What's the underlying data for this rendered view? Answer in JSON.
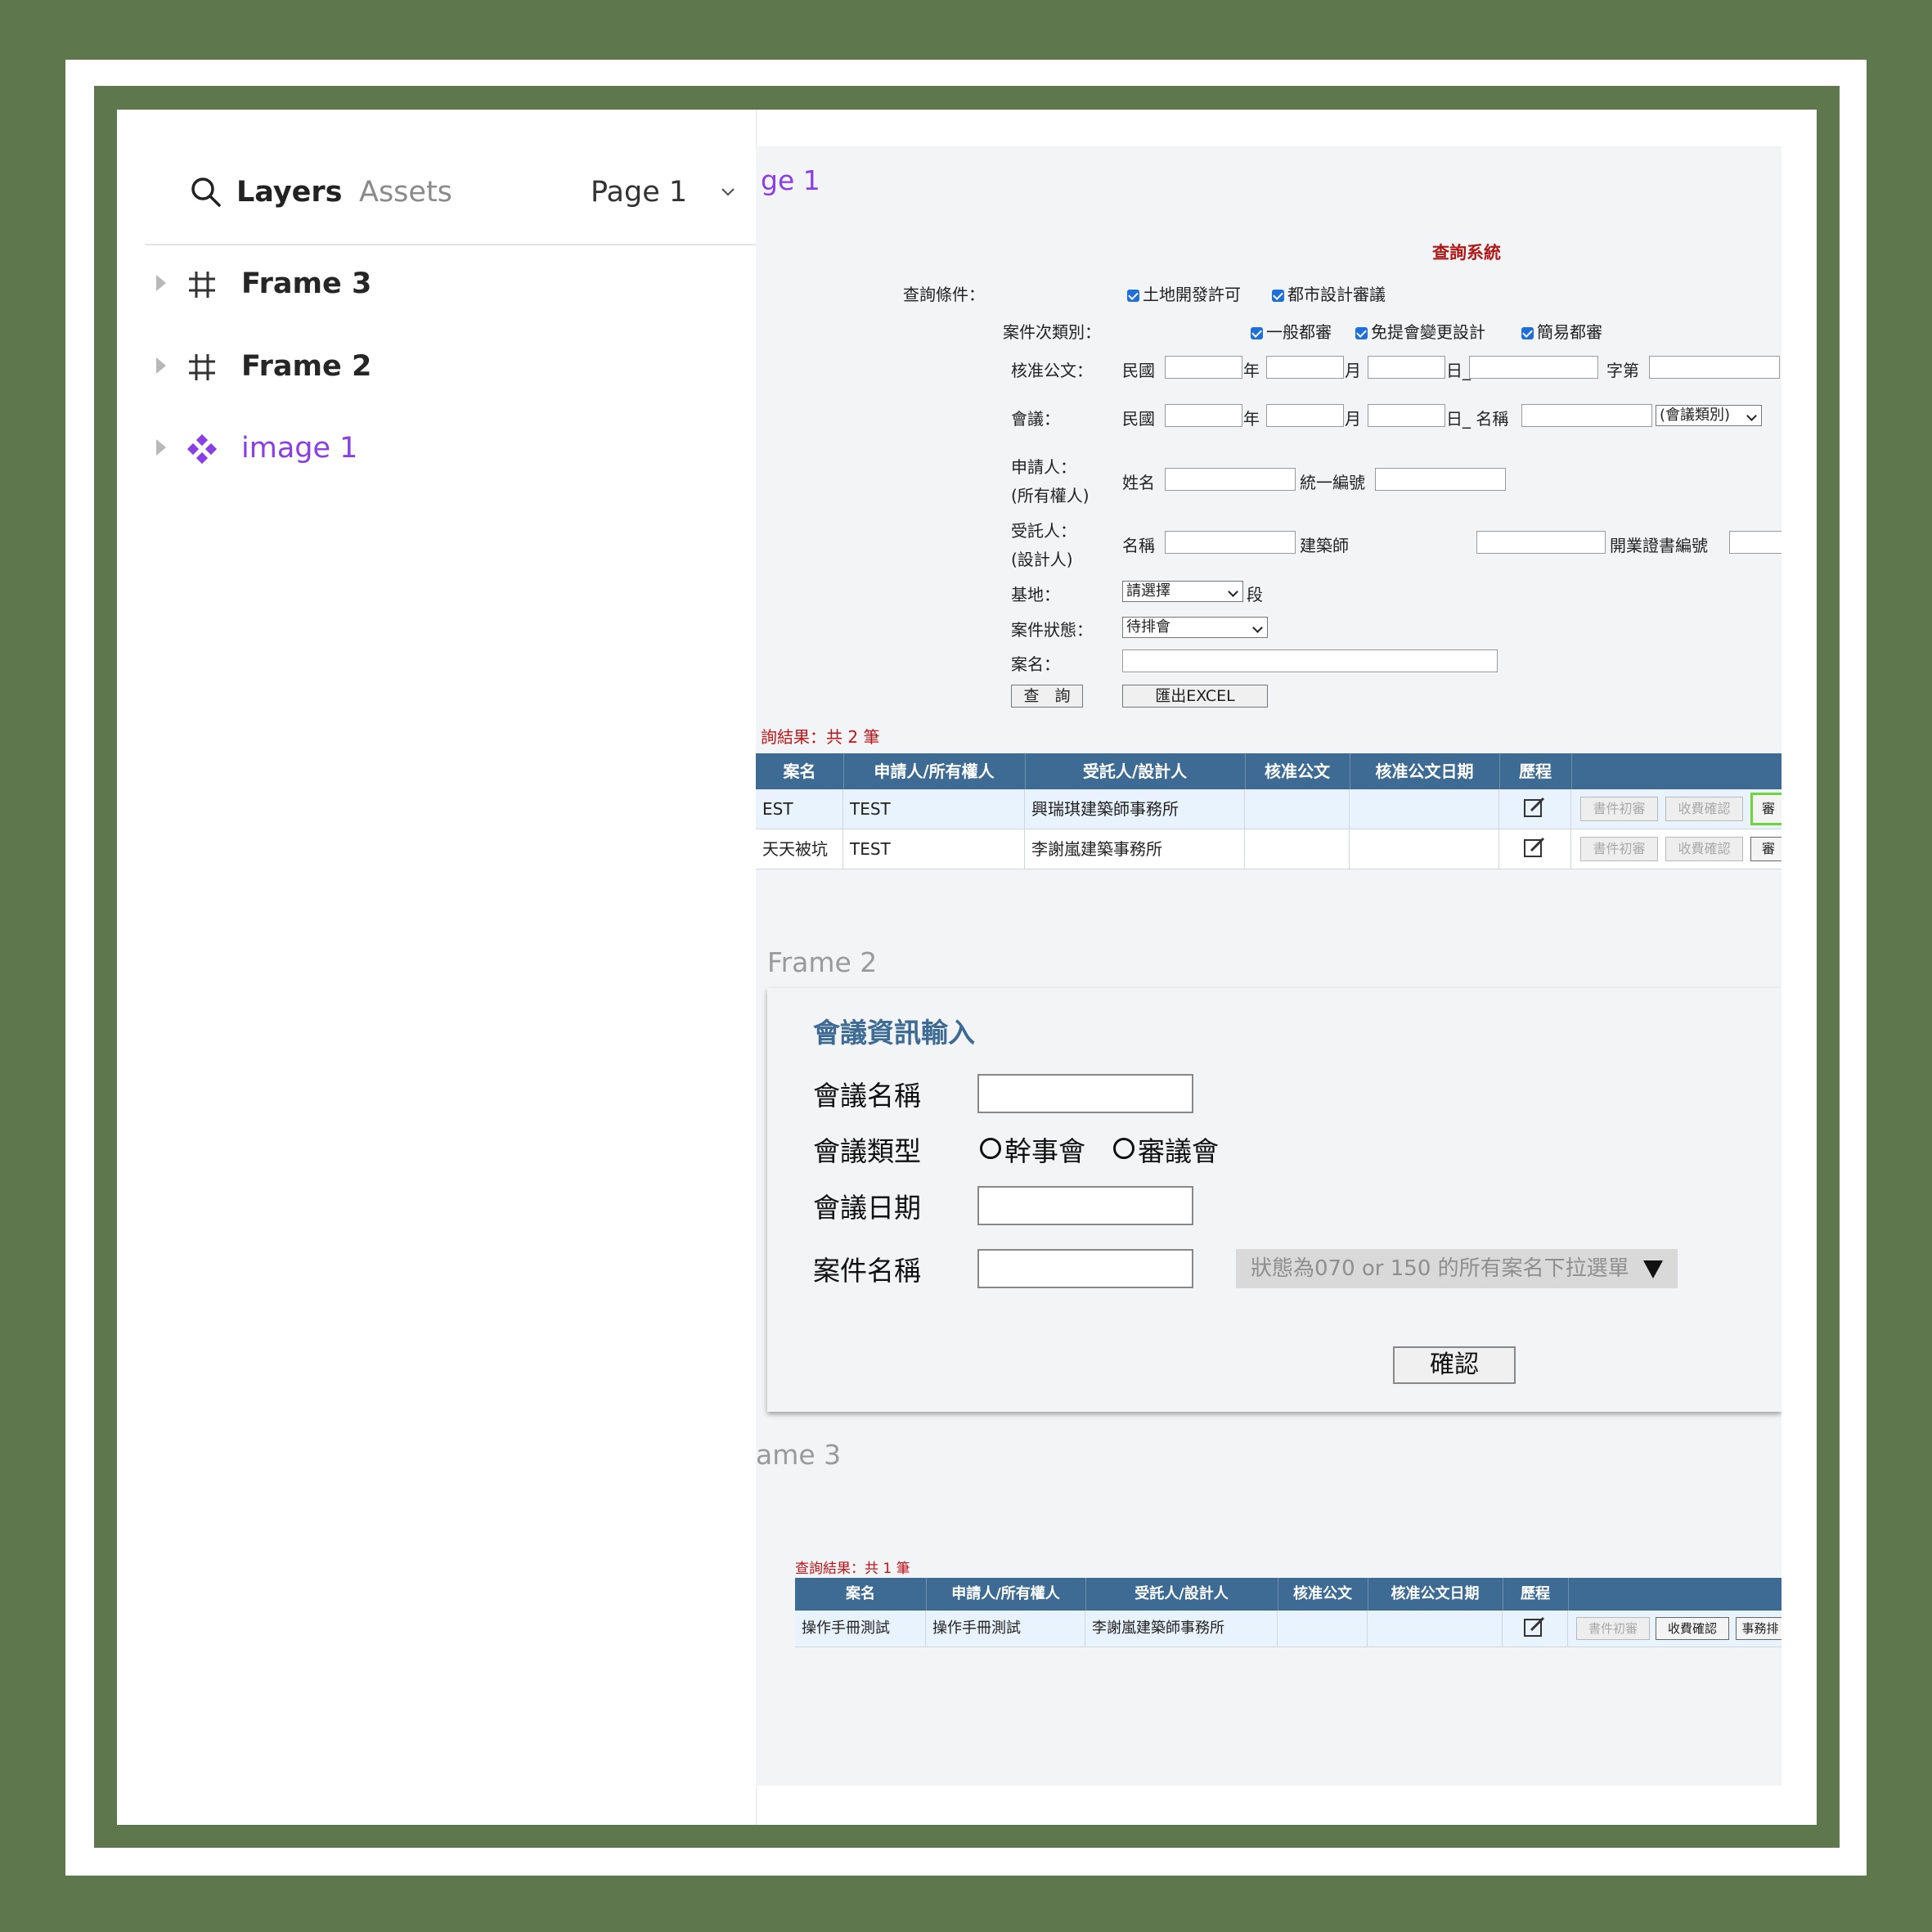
{
  "panel": {
    "tabs": {
      "layers": "Layers",
      "assets": "Assets"
    },
    "page_selector": "Page 1",
    "layers": [
      {
        "name": "Frame 3",
        "icon": "frame-icon"
      },
      {
        "name": "Frame 2",
        "icon": "frame-icon"
      },
      {
        "name": "image 1",
        "icon": "component-icon"
      }
    ]
  },
  "canvas": {
    "page_label": "ge 1",
    "frame2_label": "Frame 2",
    "frame3_label": "ame 3"
  },
  "query_form": {
    "title": "查詢系統",
    "cond_label": "查詢條件：",
    "cond_opt1": "土地開發許可",
    "cond_opt2": "都市設計審議",
    "subtype_label": "案件次類別：",
    "subtype_opt1": "一般都審",
    "subtype_opt2": "免提會變更設計",
    "subtype_opt3": "簡易都審",
    "approval_label": "核准公文：",
    "roc": "民國",
    "year": "年",
    "month": "月",
    "day_doc": "日_",
    "doc_no": "字第",
    "meeting_label": "會議：",
    "day_name": "日_ 名稱",
    "meeting_type_select": "(會議類別)",
    "applicant_label_1": "申請人：",
    "applicant_label_2": "(所有權人)",
    "applicant_name": "姓名",
    "applicant_id": "統一編號",
    "agent_label_1": "受託人：",
    "agent_label_2": "(設計人)",
    "agent_name": "名稱",
    "architect": "建築師",
    "license_no": "開業證書編號",
    "site_label": "基地：",
    "site_select": "請選擇",
    "site_suffix": "段",
    "status_label": "案件狀態：",
    "status_select": "待排會",
    "case_name_label": "案名：",
    "search_btn": "查　詢",
    "excel_btn": "匯出EXCEL"
  },
  "results1": {
    "count_text": "詢結果：共 2 筆",
    "headers": [
      "案名",
      "申請人/所有權人",
      "受託人/設計人",
      "核准公文",
      "核准公文日期",
      "歷程"
    ],
    "rows": [
      {
        "case": "EST",
        "applicant": "TEST",
        "agent": "興瑞琪建築師事務所",
        "doc": "",
        "date": ""
      },
      {
        "case": "天天被坑",
        "applicant": "TEST",
        "agent": "李謝嵐建築事務所",
        "doc": "",
        "date": ""
      }
    ],
    "action1": "書件初審",
    "action2": "收費確認",
    "action3": "審"
  },
  "dialog": {
    "title": "會議資訊輸入",
    "name_label": "會議名稱",
    "type_label": "會議類型",
    "type_opt1": "幹事會",
    "type_opt2": "審議會",
    "date_label": "會議日期",
    "case_label": "案件名稱",
    "case_dropdown": "狀態為070 or 150 的所有案名下拉選單",
    "confirm": "確認"
  },
  "results2": {
    "count_text": "查詢結果：共 1 筆",
    "headers": [
      "案名",
      "申請人/所有權人",
      "受託人/設計人",
      "核准公文",
      "核准公文日期",
      "歷程"
    ],
    "row": {
      "case": "操作手冊測試",
      "applicant": "操作手冊測試",
      "agent": "李謝嵐建築師事務所",
      "doc": "",
      "date": ""
    },
    "action1": "書件初審",
    "action2": "收費確認",
    "action3": "事務排"
  },
  "colors": {
    "background": "#5f774c",
    "accent_purple": "#8a3ee6",
    "table_header": "#3e6b93",
    "title_red": "#b01818",
    "highlight_green": "#6ed43a"
  }
}
